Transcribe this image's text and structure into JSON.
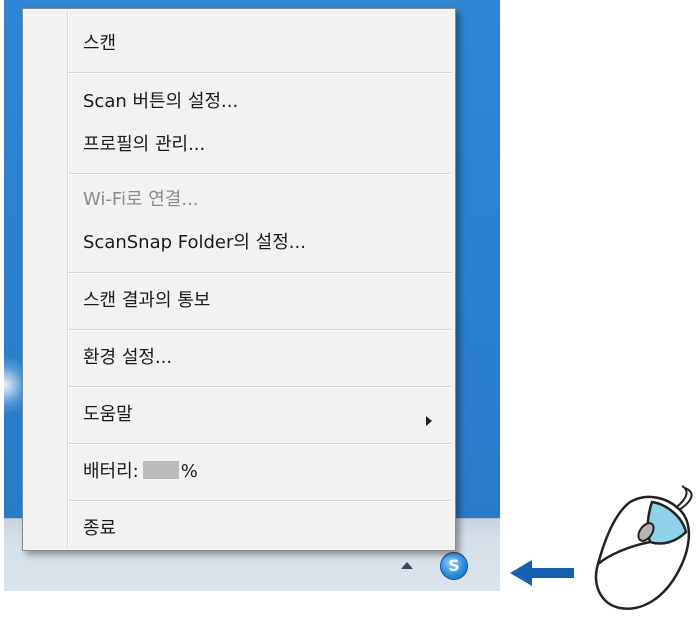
{
  "menu": {
    "items": [
      {
        "label": "스캔",
        "enabled": true
      },
      {
        "label": "Scan 버튼의 설정...",
        "enabled": true
      },
      {
        "label": "프로필의 관리...",
        "enabled": true
      },
      {
        "label": "Wi-Fi로 연결...",
        "enabled": false
      },
      {
        "label": "ScanSnap Folder의 설정...",
        "enabled": true
      },
      {
        "label": "스캔 결과의 통보",
        "enabled": true
      },
      {
        "label": "환경 설정...",
        "enabled": true
      },
      {
        "label": "도움말",
        "enabled": true,
        "submenu": true
      },
      {
        "label": "배터리:",
        "enabled": true,
        "suffix": "%"
      },
      {
        "label": "종료",
        "enabled": true
      }
    ]
  },
  "icons": {
    "tray_show_hidden": "up-arrow-icon",
    "scansnap_manager": "scansnap-manager-icon",
    "pointer": "left-arrow-icon",
    "mouse": "mouse-right-click-icon"
  },
  "colors": {
    "desktop": "#2a7fcf",
    "menu_bg": "#f2f2f2",
    "disabled_text": "#8c8c8c",
    "arrow": "#1560b0",
    "mouse_highlight": "#8fd3e8"
  }
}
